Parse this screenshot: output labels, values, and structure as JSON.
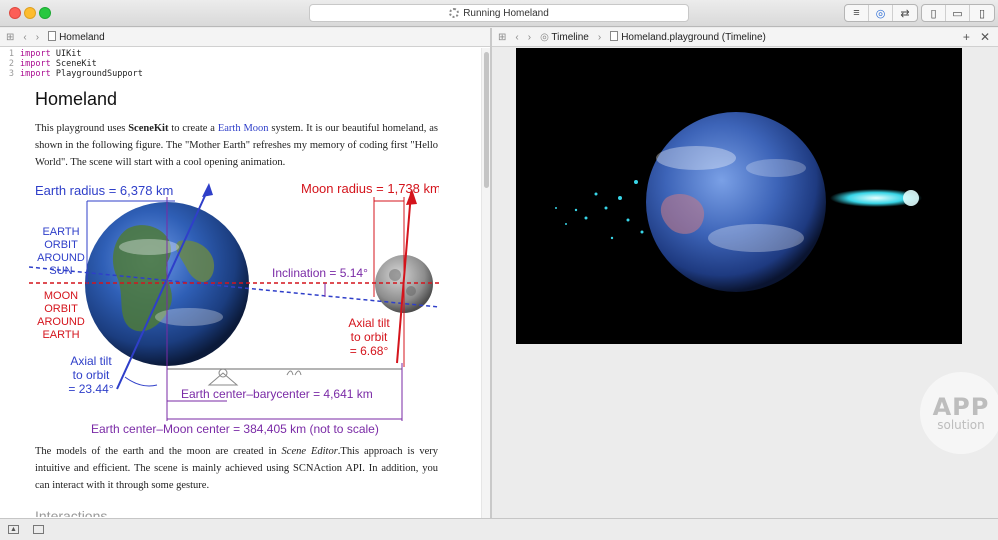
{
  "window": {
    "activity_text": "Running Homeland"
  },
  "left_editor": {
    "breadcrumb": "Homeland",
    "code_lines": [
      {
        "num": "1",
        "keyword": "import",
        "module": "UIKit"
      },
      {
        "num": "2",
        "keyword": "import",
        "module": "SceneKit"
      },
      {
        "num": "3",
        "keyword": "import",
        "module": "PlaygroundSupport"
      }
    ],
    "doc": {
      "title": "Homeland",
      "para1_a": "This playground uses ",
      "para1_bold": "SceneKit",
      "para1_b": " to create a ",
      "para1_link": "Earth Moon",
      "para1_c": " system. It is our beautiful homeland, as shown in the following figure. The \"Mother Earth\" refreshes my memory of coding first \"Hello World\". The scene will start with a cool opening animation.",
      "para2_a": "The models of the earth and the moon are created in ",
      "para2_italic": "Scene Editor",
      "para2_b": ".This approach is very intuitive and efficient. The scene is mainly achieved using SCNAction API. In addition, you can interact with it through some gesture.",
      "section_heading": "Interactions"
    },
    "figure": {
      "earth_radius": "Earth radius = 6,378 km",
      "moon_radius": "Moon radius = 1,738 km",
      "earth_orbit_1": "EARTH",
      "earth_orbit_2": "ORBIT",
      "earth_orbit_3": "AROUND",
      "earth_orbit_4": "SUN",
      "moon_orbit_1": "MOON",
      "moon_orbit_2": "ORBIT",
      "moon_orbit_3": "AROUND",
      "moon_orbit_4": "EARTH",
      "inclination": "Inclination = 5.14°",
      "moon_tilt_1": "Axial tilt",
      "moon_tilt_2": "to orbit",
      "moon_tilt_3": "= 6.68°",
      "earth_tilt_1": "Axial tilt",
      "earth_tilt_2": "to orbit",
      "earth_tilt_3": "= 23.44°",
      "barycenter": "Earth center–barycenter = 4,641 km",
      "moon_distance": "Earth center–Moon center = 384,405 km (not to scale)"
    }
  },
  "right_editor": {
    "breadcrumb_1": "Timeline",
    "breadcrumb_2": "Homeland.playground (Timeline)",
    "add_symbol": "+",
    "close_symbol": "✕"
  },
  "watermark": {
    "big": "APP",
    "small": "solution"
  },
  "colors": {
    "blue_label": "#2f3fc9",
    "red_label": "#d4141c",
    "purple_label": "#7a2aa6"
  }
}
